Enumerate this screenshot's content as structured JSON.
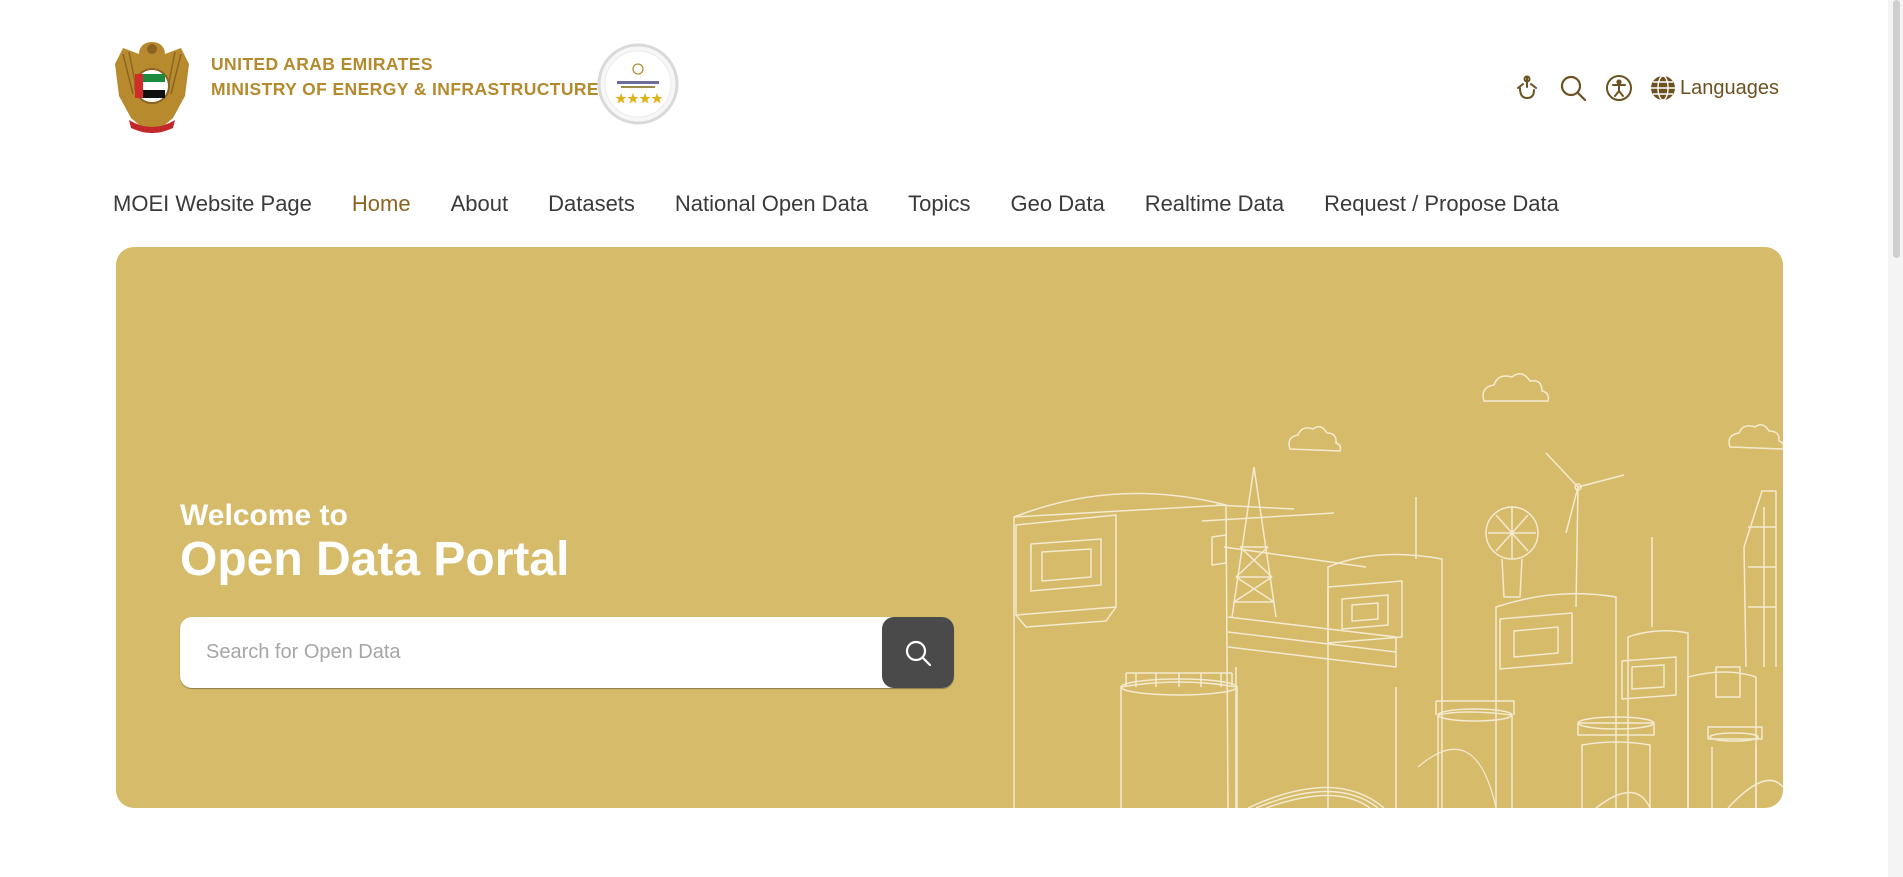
{
  "header": {
    "ministry_line1": "UNITED ARAB EMIRATES",
    "ministry_line2": "MINISTRY OF ENERGY & INFRASTRUCTURE",
    "languages_label": "Languages",
    "icons": [
      "sign-language-icon",
      "search-icon",
      "accessibility-icon",
      "globe-icon"
    ]
  },
  "nav": {
    "items": [
      {
        "label": "MOEI Website Page"
      },
      {
        "label": "Home",
        "active": true
      },
      {
        "label": "About"
      },
      {
        "label": "Datasets"
      },
      {
        "label": "National Open Data"
      },
      {
        "label": "Topics"
      },
      {
        "label": "Geo Data"
      },
      {
        "label": "Realtime Data"
      },
      {
        "label": "Request / Propose Data"
      }
    ]
  },
  "hero": {
    "welcome": "Welcome to",
    "title": "Open Data Portal",
    "search_placeholder": "Search for Open Data"
  },
  "colors": {
    "brand_gold": "#b48a2c",
    "hero_bg": "#d6bb6b",
    "nav_active": "#8a6622",
    "search_button": "#4a4a4a"
  }
}
